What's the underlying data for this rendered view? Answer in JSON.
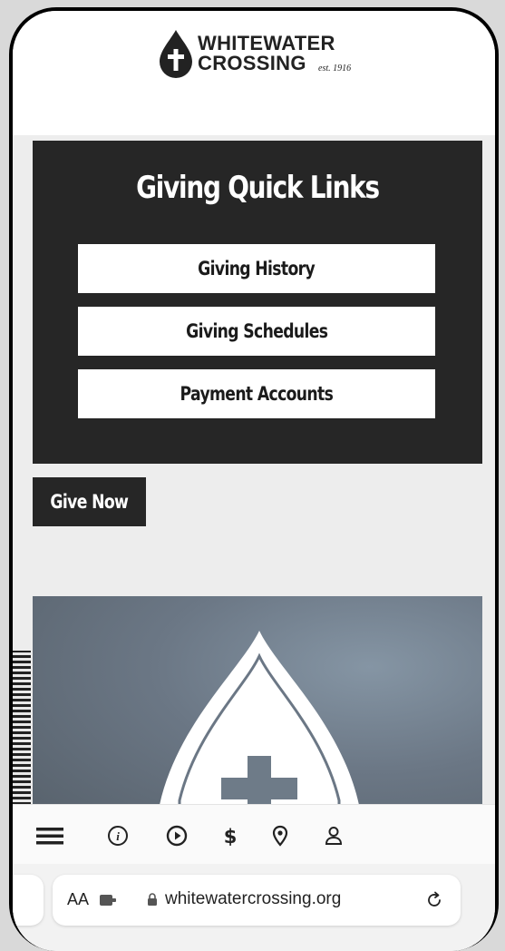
{
  "brand": {
    "line1": "WHITEWATER",
    "line2": "CROSSING",
    "est": "est. 1916"
  },
  "quick_links": {
    "title": "Giving Quick Links",
    "items": [
      {
        "label": "Giving History"
      },
      {
        "label": "Giving Schedules"
      },
      {
        "label": "Payment Accounts"
      }
    ]
  },
  "give_now": {
    "label": "Give Now"
  },
  "tabbar": {
    "icons": [
      "menu-icon",
      "info-icon",
      "play-icon",
      "dollar-icon",
      "location-pin-icon",
      "user-icon"
    ]
  },
  "browser": {
    "text_size_label": "AA",
    "url": "whitewatercrossing.org"
  },
  "colors": {
    "dark": "#262626",
    "page_bg": "#ededed",
    "white": "#ffffff"
  }
}
